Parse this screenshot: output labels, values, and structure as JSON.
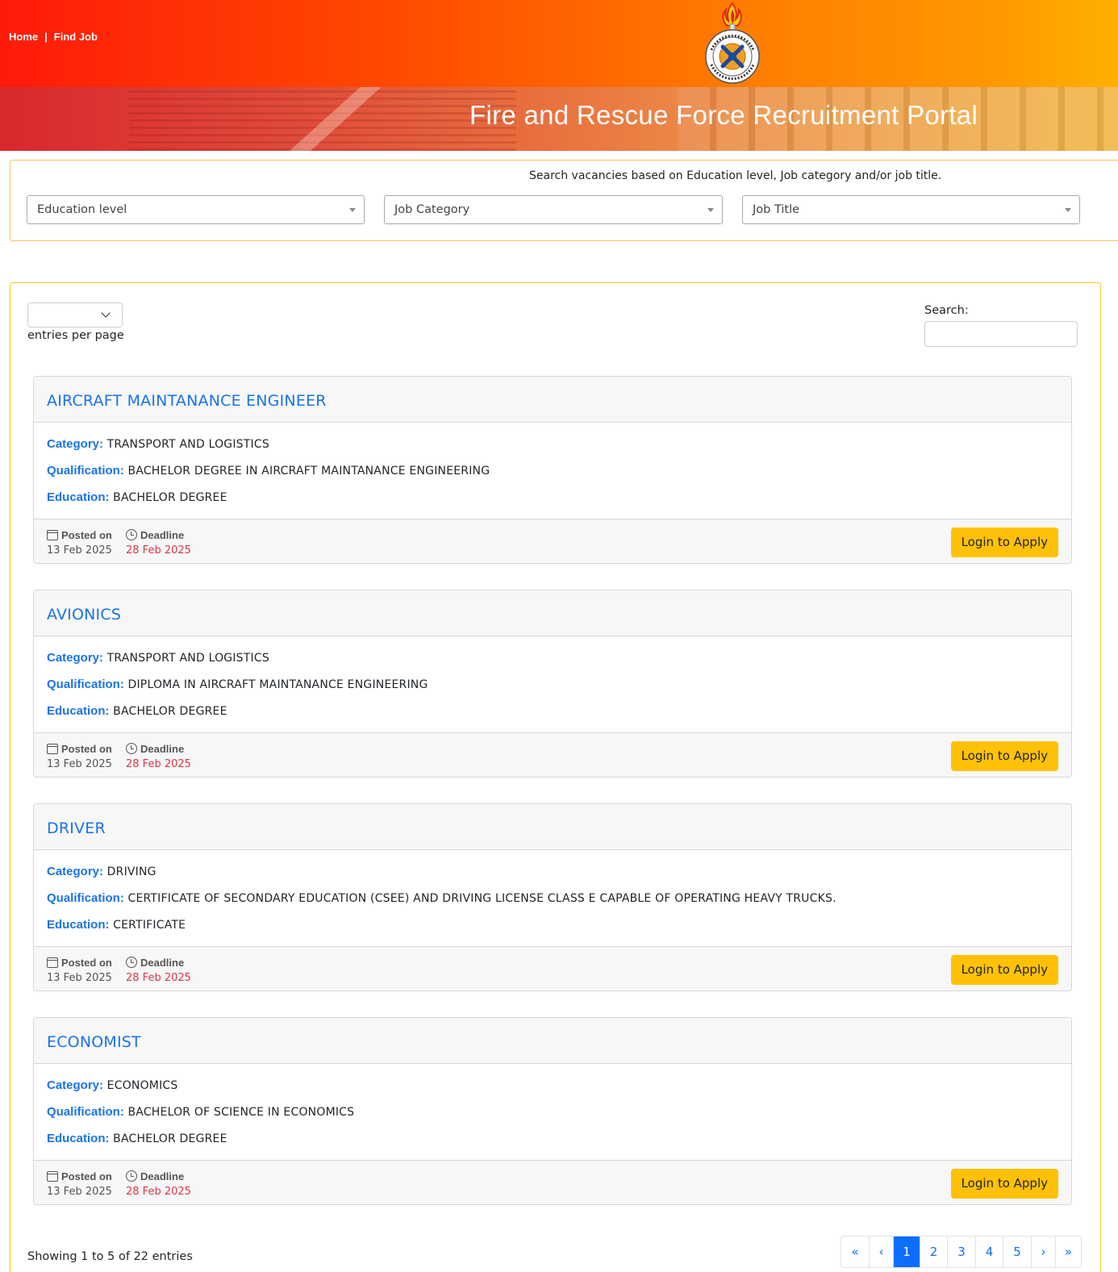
{
  "nav": {
    "home": "Home",
    "separator": "|",
    "find_job": "Find Job"
  },
  "banner": {
    "title": "Fire and Rescue Force Recruitment Portal"
  },
  "filters": {
    "hint": "Search vacancies based on Education level, Job category and/or job title.",
    "education_level": "Education level",
    "job_category": "Job Category",
    "job_title": "Job Title"
  },
  "table_controls": {
    "entries_value": "",
    "entries_label": "entries per page",
    "search_label": "Search:",
    "search_value": ""
  },
  "labels": {
    "category": "Category:",
    "qualification": "Qualification:",
    "education": "Education:",
    "posted_on": "Posted on",
    "deadline": "Deadline",
    "apply": "Login to Apply"
  },
  "jobs": [
    {
      "title": "AIRCRAFT MAINTANANCE ENGINEER",
      "category": "TRANSPORT AND LOGISTICS",
      "qualification": "BACHELOR DEGREE IN AIRCRAFT MAINTANANCE ENGINEERING",
      "education": "BACHELOR DEGREE",
      "posted": "13 Feb 2025",
      "deadline": "28 Feb 2025"
    },
    {
      "title": "AVIONICS",
      "category": "TRANSPORT AND LOGISTICS",
      "qualification": "DIPLOMA IN AIRCRAFT MAINTANANCE ENGINEERING",
      "education": "BACHELOR DEGREE",
      "posted": "13 Feb 2025",
      "deadline": "28 Feb 2025"
    },
    {
      "title": "DRIVER",
      "category": "DRIVING",
      "qualification": "CERTIFICATE OF SECONDARY EDUCATION (CSEE) AND DRIVING LICENSE CLASS E CAPABLE OF OPERATING HEAVY TRUCKS.",
      "education": "CERTIFICATE",
      "posted": "13 Feb 2025",
      "deadline": "28 Feb 2025"
    },
    {
      "title": "ECONOMIST",
      "category": "ECONOMICS",
      "qualification": "BACHELOR OF SCIENCE IN ECONOMICS",
      "education": "BACHELOR DEGREE",
      "posted": "13 Feb 2025",
      "deadline": "28 Feb 2025"
    }
  ],
  "footer": {
    "showing": "Showing 1 to 5 of 22 entries"
  },
  "pagination": {
    "first": "«",
    "prev": "‹",
    "pages": [
      "1",
      "2",
      "3",
      "4",
      "5"
    ],
    "next": "›",
    "last": "»",
    "active": "1"
  },
  "colors": {
    "accent": "#1a73e8",
    "button": "#ffc107",
    "deadline": "#dc3545",
    "header_start": "#ff1a0a",
    "header_end": "#ffb000"
  },
  "icons": {
    "posted": "calendar-icon",
    "deadline": "clock-icon",
    "dropdown": "chevron-down-icon"
  }
}
